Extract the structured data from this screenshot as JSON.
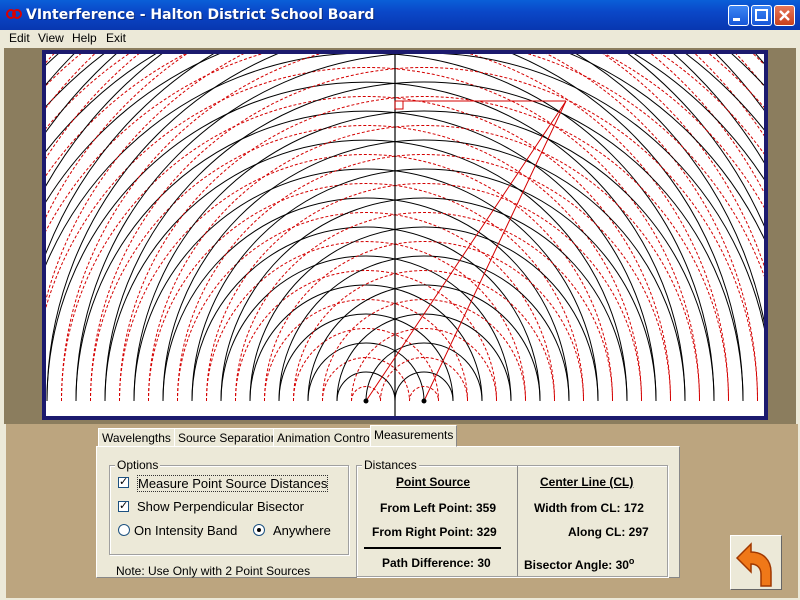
{
  "window": {
    "title": "VInterference - Halton District School Board"
  },
  "menu": [
    "Edit",
    "View",
    "Help",
    "Exit"
  ],
  "tabs": [
    "Wavelengths",
    "Source Separation",
    "Animation Controls",
    "Measurements"
  ],
  "active_tab": 3,
  "options": {
    "legend": "Options",
    "measure_label": "Measure Point Source Distances",
    "measure_checked": true,
    "bisector_label": "Show Perpendicular Bisector",
    "bisector_checked": true,
    "radio_band_label": "On Intensity Band",
    "radio_anywhere_label": "Anywhere",
    "selected_radio": "anywhere"
  },
  "note": "Note: Use Only with 2 Point Sources",
  "distances": {
    "legend": "Distances",
    "point_source_header": "Point Source",
    "from_left": "From Left Point: 359",
    "from_right": "From Right Point: 329",
    "path_difference": "Path Difference: 30",
    "center_line_header": "Center Line (CL)",
    "width_from_cl": "Width from CL: 172",
    "along_cl": "Along CL: 297",
    "bisector_angle": "Bisector Angle: 30",
    "degree_symbol": "o"
  },
  "colors": {
    "crest": "#000000",
    "trough": "#d40000",
    "canvas_border": "#1c1a6e",
    "panel": "#bca57f"
  },
  "icons": {
    "back": "back-arrow-icon"
  }
}
